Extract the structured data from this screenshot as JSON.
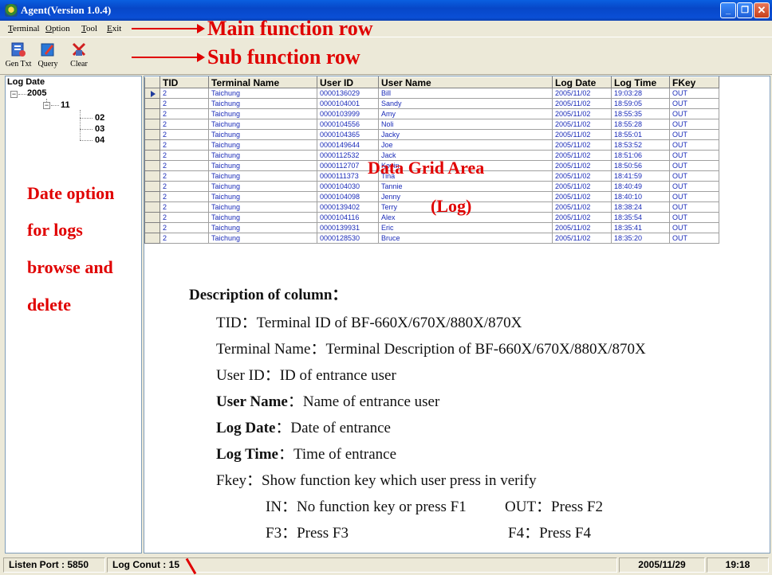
{
  "window": {
    "title": "Agent(Version 1.0.4)"
  },
  "menu": [
    {
      "pre": "",
      "u": "T",
      "post": "erminal"
    },
    {
      "pre": "",
      "u": "O",
      "post": "ption"
    },
    {
      "pre": "",
      "u": "T",
      "post": "ool"
    },
    {
      "pre": "",
      "u": "E",
      "post": "xit"
    }
  ],
  "toolbar": {
    "gentxt": "Gen Txt",
    "query": "Query",
    "clear": "Clear"
  },
  "annotations": {
    "main_row": "Main function row",
    "sub_row": "Sub function row",
    "date_option": [
      "Date option",
      "for logs",
      "browse and",
      "delete"
    ],
    "grid_area": "Data Grid Area",
    "grid_log": "(Log)"
  },
  "tree": {
    "root": "Log Date",
    "year": "2005",
    "month": "11",
    "days": [
      "02",
      "03",
      "04"
    ]
  },
  "grid": {
    "columns": [
      "TID",
      "Terminal Name",
      "User ID",
      "User Name",
      "Log Date",
      "Log Time",
      "FKey"
    ],
    "rows": [
      [
        "2",
        "Taichung",
        "0000136029",
        "Bill",
        "2005/11/02",
        "19:03:28",
        "OUT"
      ],
      [
        "2",
        "Taichung",
        "0000104001",
        "Sandy",
        "2005/11/02",
        "18:59:05",
        "OUT"
      ],
      [
        "2",
        "Taichung",
        "0000103999",
        "Amy",
        "2005/11/02",
        "18:55:35",
        "OUT"
      ],
      [
        "2",
        "Taichung",
        "0000104556",
        "Noli",
        "2005/11/02",
        "18:55:28",
        "OUT"
      ],
      [
        "2",
        "Taichung",
        "0000104365",
        "Jacky",
        "2005/11/02",
        "18:55:01",
        "OUT"
      ],
      [
        "2",
        "Taichung",
        "0000149644",
        "Joe",
        "2005/11/02",
        "18:53:52",
        "OUT"
      ],
      [
        "2",
        "Taichung",
        "0000112532",
        "Jack",
        "2005/11/02",
        "18:51:06",
        "OUT"
      ],
      [
        "2",
        "Taichung",
        "0000112707",
        "Kevin",
        "2005/11/02",
        "18:50:56",
        "OUT"
      ],
      [
        "2",
        "Taichung",
        "0000111373",
        "Tina",
        "2005/11/02",
        "18:41:59",
        "OUT"
      ],
      [
        "2",
        "Taichung",
        "0000104030",
        "Tannie",
        "2005/11/02",
        "18:40:49",
        "OUT"
      ],
      [
        "2",
        "Taichung",
        "0000104098",
        "Jenny",
        "2005/11/02",
        "18:40:10",
        "OUT"
      ],
      [
        "2",
        "Taichung",
        "0000139402",
        "Terry",
        "2005/11/02",
        "18:38:24",
        "OUT"
      ],
      [
        "2",
        "Taichung",
        "0000104116",
        "Alex",
        "2005/11/02",
        "18:35:54",
        "OUT"
      ],
      [
        "2",
        "Taichung",
        "0000139931",
        "Eric",
        "2005/11/02",
        "18:35:41",
        "OUT"
      ],
      [
        "2",
        "Taichung",
        "0000128530",
        "Bruce",
        "2005/11/02",
        "18:35:20",
        "OUT"
      ]
    ]
  },
  "description": {
    "title": "Description of column：",
    "lines": [
      {
        "key": "TID",
        "text": "：Terminal ID of BF-660X/670X/880X/870X",
        "bold": false
      },
      {
        "key": "Terminal Name",
        "text": "：Terminal Description of BF-660X/670X/880X/870X",
        "bold": false
      },
      {
        "key": "User ID",
        "text": "：ID of entrance user",
        "bold": false
      },
      {
        "key": "User Name",
        "text": "：Name of entrance user",
        "bold": true
      },
      {
        "key": "Log Date",
        "text": "：Date of entrance",
        "bold": true
      },
      {
        "key": "Log Time",
        "text": "：Time of entrance",
        "bold": true
      },
      {
        "key": "Fkey",
        "text": "：Show function key which user press in verify",
        "bold": false
      }
    ],
    "fkeys": [
      {
        "label": "IN：No function key or press F1"
      },
      {
        "label": "OUT：Press F2"
      },
      {
        "label": "F3：Press F3"
      },
      {
        "label": "F4：Press F4"
      }
    ]
  },
  "status": {
    "port": "Listen Port : 5850",
    "count": "Log Conut : 15",
    "date": "2005/11/29",
    "time": "19:18"
  },
  "colors": {
    "annotation": "#e00000",
    "grid_text": "#1a2bb8",
    "titlebar": "#0a4fd6"
  }
}
